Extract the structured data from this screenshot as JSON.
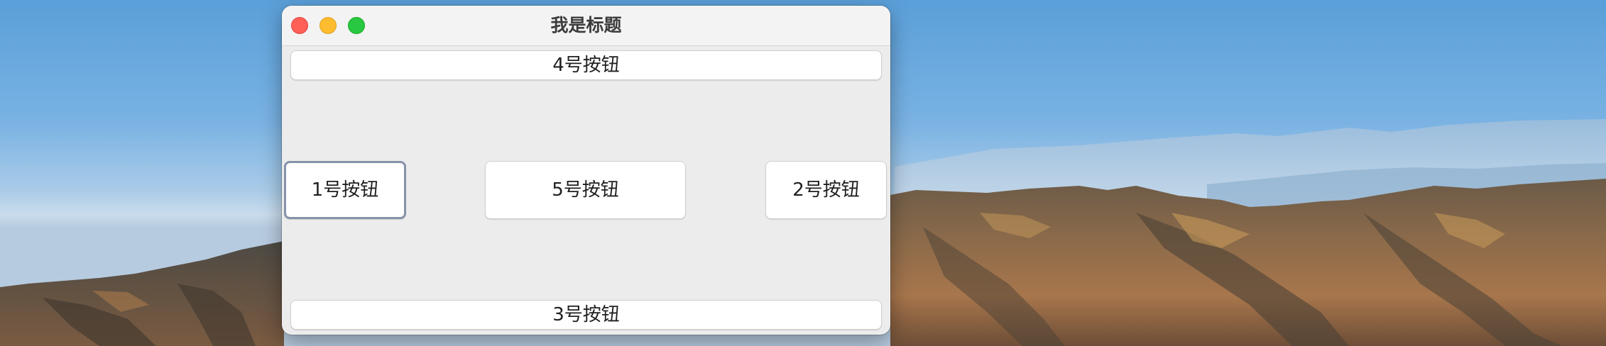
{
  "window": {
    "title": "我是标题"
  },
  "buttons": {
    "north": "4号按钮",
    "west": "1号按钮",
    "center": "5号按钮",
    "east": "2号按钮",
    "south": "3号按钮"
  },
  "colors": {
    "close": "#fe5f57",
    "minimize": "#febc2e",
    "maximize": "#28c840",
    "focus_ring": "#8793ab",
    "window_bg": "#ececec"
  },
  "icons": [
    "close-icon",
    "minimize-icon",
    "maximize-icon"
  ]
}
